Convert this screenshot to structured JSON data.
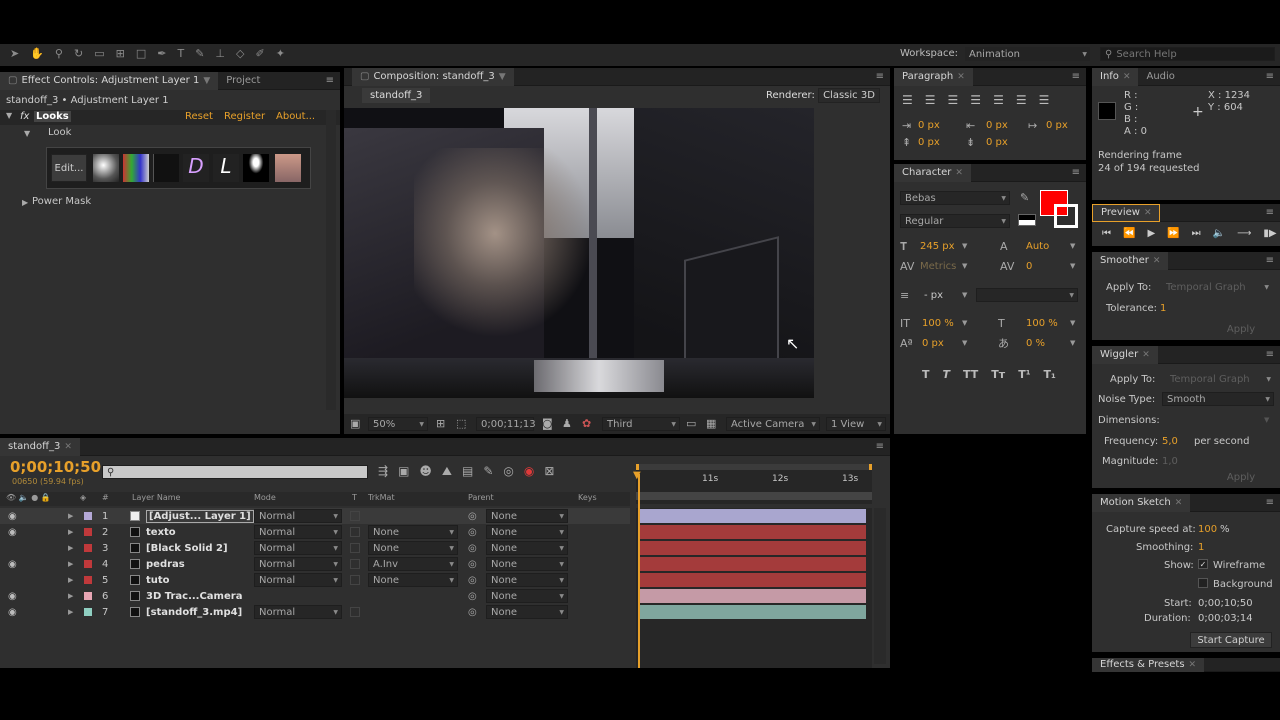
{
  "toolbar": {
    "workspace_label": "Workspace:",
    "workspace_value": "Animation",
    "search_placeholder": "Search Help"
  },
  "effects_panel": {
    "tab_effect": "Effect Controls: Adjustment Layer 1",
    "tab_project": "Project",
    "subtitle": "standoff_3 • Adjustment Layer 1",
    "fx_name": "Looks",
    "reset": "Reset",
    "register": "Register",
    "about": "About...",
    "look_label": "Look",
    "edit_label": "Edit...",
    "power_mask": "Power Mask"
  },
  "composition": {
    "tab": "Composition: standoff_3",
    "comp_tab": "standoff_3",
    "renderer_label": "Renderer:",
    "renderer_value": "Classic 3D",
    "zoom": "50%",
    "timecode": "0;00;11;13",
    "resolution": "Third",
    "camera": "Active Camera",
    "views": "1 View"
  },
  "paragraph": {
    "tab": "Paragraph",
    "indent1": "0 px",
    "indent2": "0 px",
    "indent3": "0 px",
    "space1": "0 px",
    "space2": "0 px"
  },
  "character": {
    "tab": "Character",
    "font": "Bebas",
    "style": "Regular",
    "size": "245 px",
    "leading": "Auto",
    "kerning": "Metrics",
    "tracking": "0",
    "stroke": "- px",
    "vscale": "100 %",
    "hscale": "100 %",
    "baseline": "0 px",
    "tsume": "0 %",
    "fill_color": "#ff0000"
  },
  "info": {
    "tab_info": "Info",
    "tab_audio": "Audio",
    "r": "R :",
    "g": "G :",
    "b": "B :",
    "a": "A : 0",
    "x": "X : 1234",
    "y": "Y : 604",
    "status1": "Rendering frame",
    "status2": "24 of 194 requested"
  },
  "preview": {
    "tab": "Preview"
  },
  "smoother": {
    "tab": "Smoother",
    "apply_label": "Apply To:",
    "apply_value": "Temporal Graph",
    "tolerance_label": "Tolerance:",
    "tolerance_value": "1",
    "apply_btn": "Apply"
  },
  "wiggler": {
    "tab": "Wiggler",
    "apply_label": "Apply To:",
    "apply_value": "Temporal Graph",
    "noise_label": "Noise Type:",
    "noise_value": "Smooth",
    "dimensions_label": "Dimensions:",
    "frequency_label": "Frequency:",
    "frequency_value": "5,0",
    "frequency_unit": "per second",
    "magnitude_label": "Magnitude:",
    "magnitude_value": "1,0",
    "apply_btn": "Apply"
  },
  "motion_sketch": {
    "tab": "Motion Sketch",
    "capture_label": "Capture speed at:",
    "capture_value": "100",
    "capture_unit": "%",
    "smoothing_label": "Smoothing:",
    "smoothing_value": "1",
    "show_label": "Show:",
    "wireframe": "Wireframe",
    "background": "Background",
    "start_label": "Start:",
    "start_value": "0;00;10;50",
    "duration_label": "Duration:",
    "duration_value": "0;00;03;14",
    "capture_btn": "Start Capture"
  },
  "effects_presets": {
    "tab": "Effects & Presets"
  },
  "timeline": {
    "tab": "standoff_3",
    "timecode": "0;00;10;50",
    "frames": "00650 (59.94 fps)",
    "columns": {
      "num": "#",
      "layer_name": "Layer Name",
      "mode": "Mode",
      "t": "T",
      "trkmat": "TrkMat",
      "parent": "Parent",
      "keys": "Keys"
    },
    "ruler": [
      "11s",
      "12s",
      "13s"
    ],
    "layers": [
      {
        "num": "1",
        "name": "[Adjust... Layer 1]",
        "mode": "Normal",
        "trkmat": "",
        "parent": "None",
        "label_color": "#b4a8d6",
        "bar_color": "#a9a6cf"
      },
      {
        "num": "2",
        "name": "texto",
        "mode": "Normal",
        "trkmat": "None",
        "parent": "None",
        "label_color": "#c0393b",
        "bar_color": "#a43b3b"
      },
      {
        "num": "3",
        "name": "[Black Solid 2]",
        "mode": "Normal",
        "trkmat": "None",
        "parent": "None",
        "label_color": "#c0393b",
        "bar_color": "#a43b3b"
      },
      {
        "num": "4",
        "name": "pedras",
        "mode": "Normal",
        "trkmat": "A.Inv",
        "parent": "None",
        "label_color": "#c0393b",
        "bar_color": "#a43b3b"
      },
      {
        "num": "5",
        "name": "tuto",
        "mode": "Normal",
        "trkmat": "None",
        "parent": "None",
        "label_color": "#c0393b",
        "bar_color": "#a43b3b"
      },
      {
        "num": "6",
        "name": "3D Trac...Camera",
        "mode": "",
        "trkmat": "",
        "parent": "None",
        "label_color": "#e8a6b4",
        "bar_color": "#c59aa6"
      },
      {
        "num": "7",
        "name": "[standoff_3.mp4]",
        "mode": "Normal",
        "trkmat": "",
        "parent": "None",
        "label_color": "#8fcfc1",
        "bar_color": "#7fa69e"
      }
    ]
  }
}
